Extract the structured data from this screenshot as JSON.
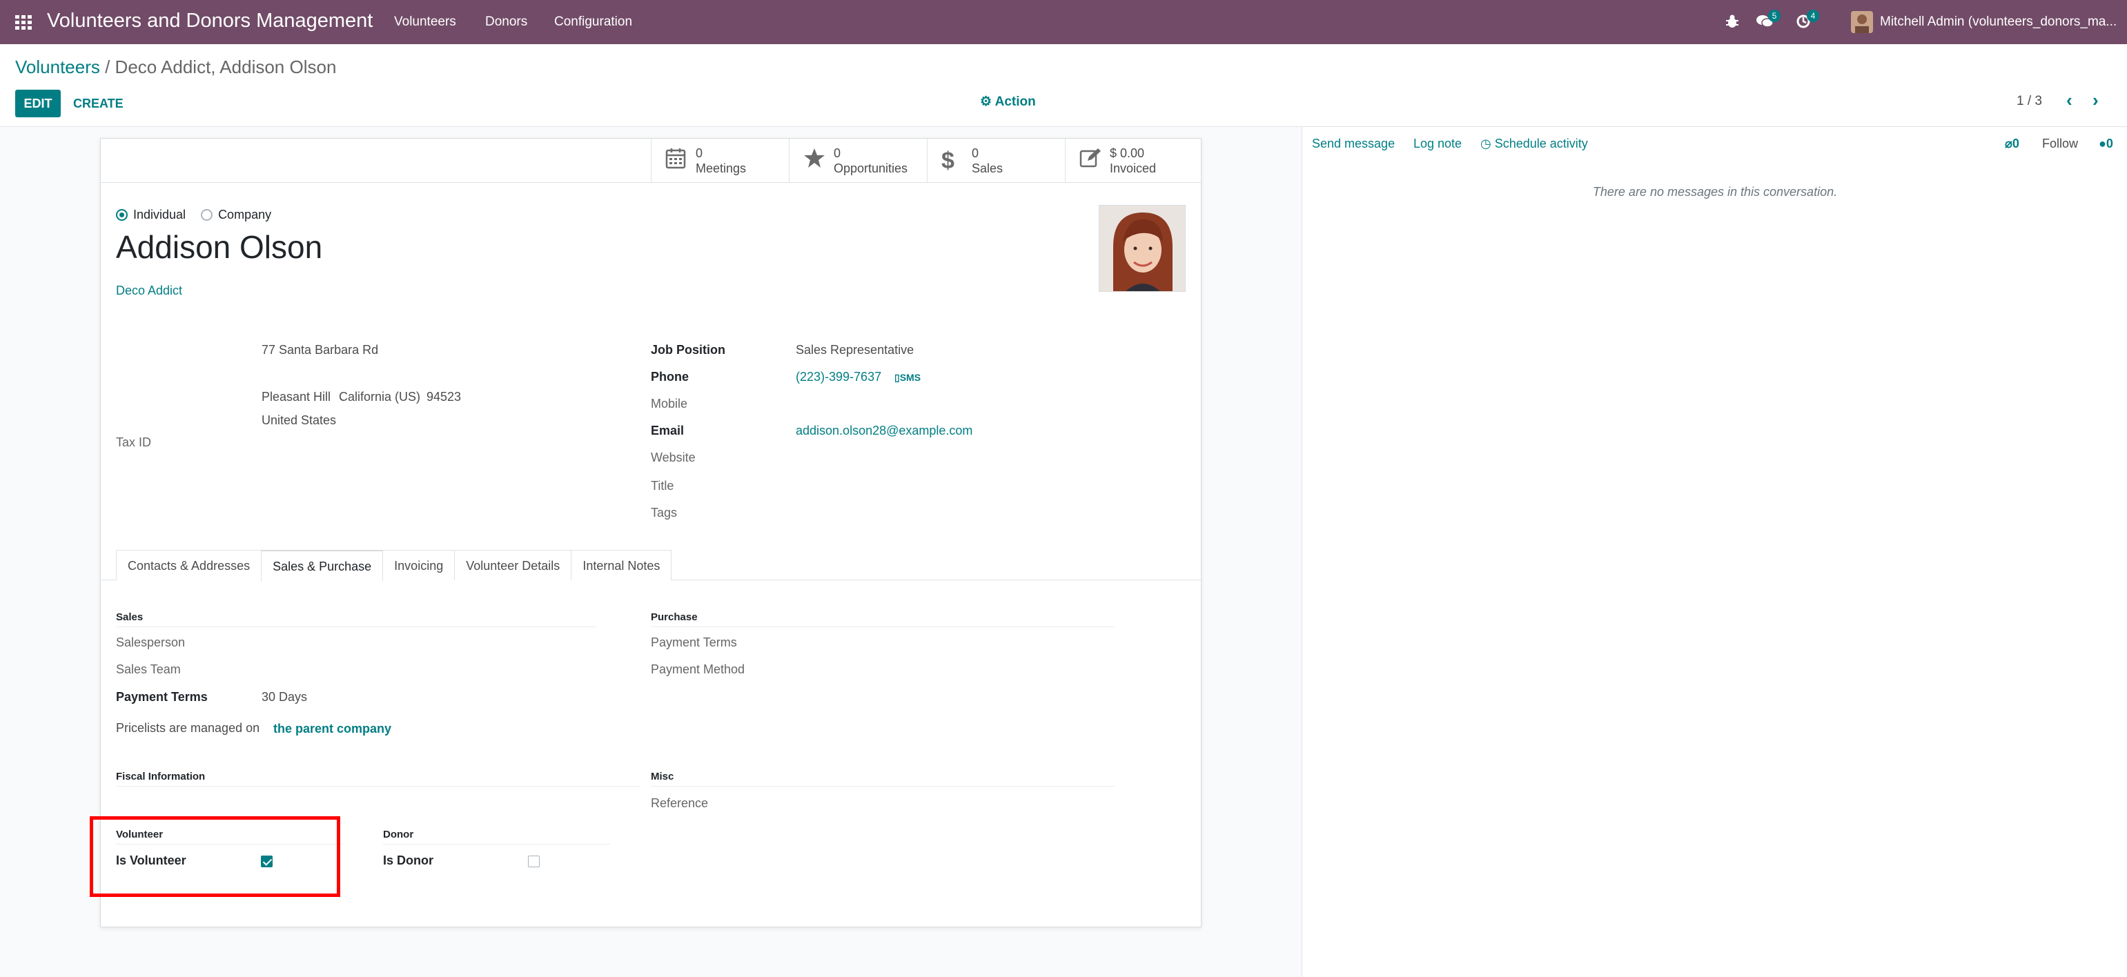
{
  "navbar": {
    "app_title": "Volunteers and Donors Management",
    "menu": [
      "Volunteers",
      "Donors",
      "Configuration"
    ],
    "messages_count": "5",
    "activities_count": "4",
    "user": "Mitchell Admin (volunteers_donors_ma..."
  },
  "breadcrumb": {
    "parent": "Volunteers",
    "separator": " / ",
    "current": "Deco Addict, Addison Olson"
  },
  "toolbar": {
    "edit_label": "EDIT",
    "create_label": "CREATE",
    "action_label": "Action",
    "pager": "1 / 3"
  },
  "stat_buttons": [
    {
      "value": "0",
      "label": "Meetings",
      "icon": "calendar-icon"
    },
    {
      "value": "0",
      "label": "Opportunities",
      "icon": "star-icon"
    },
    {
      "value": "0",
      "label": "Sales",
      "icon": "dollar-icon"
    },
    {
      "value": "$ 0.00",
      "label": "Invoiced",
      "icon": "edit-icon"
    }
  ],
  "partner": {
    "type_options": [
      "Individual",
      "Company"
    ],
    "selected_type": "Individual",
    "name": "Addison Olson",
    "parent_company": "Deco Addict",
    "address": {
      "street": "77 Santa Barbara Rd",
      "city": "Pleasant Hill",
      "state": "California (US)",
      "zip": "94523",
      "country": "United States"
    },
    "tax_id_label": "Tax ID"
  },
  "contact_fields": {
    "job_position_label": "Job Position",
    "job_position": "Sales Representative",
    "phone_label": "Phone",
    "phone": "(223)-399-7637",
    "sms_label": "SMS",
    "mobile_label": "Mobile",
    "email_label": "Email",
    "email": "addison.olson28@example.com",
    "website_label": "Website",
    "title_label": "Title",
    "tags_label": "Tags"
  },
  "tabs": [
    "Contacts & Addresses",
    "Sales & Purchase",
    "Invoicing",
    "Volunteer Details",
    "Internal Notes"
  ],
  "active_tab": "Sales & Purchase",
  "sales": {
    "section_title": "Sales",
    "salesperson_label": "Salesperson",
    "sales_team_label": "Sales Team",
    "payment_terms_label": "Payment Terms",
    "payment_terms": "30 Days",
    "pricelist_text": "Pricelists are managed on",
    "pricelist_link": "the parent company"
  },
  "purchase": {
    "section_title": "Purchase",
    "payment_terms_label": "Payment Terms",
    "payment_method_label": "Payment Method"
  },
  "fiscal": {
    "section_title": "Fiscal Information"
  },
  "misc": {
    "section_title": "Misc",
    "reference_label": "Reference"
  },
  "volunteer": {
    "section_title": "Volunteer",
    "is_volunteer_label": "Is Volunteer",
    "is_volunteer": true
  },
  "donor": {
    "section_title": "Donor",
    "is_donor_label": "Is Donor",
    "is_donor": false
  },
  "chatter": {
    "send_message": "Send message",
    "log_note": "Log note",
    "schedule_activity": "Schedule activity",
    "attachments_count": "0",
    "follow": "Follow",
    "followers_count": "0",
    "empty_text": "There are no messages in this conversation."
  },
  "colors": {
    "brand": "#714B67",
    "accent": "#017e84",
    "highlight": "#ff0000"
  }
}
